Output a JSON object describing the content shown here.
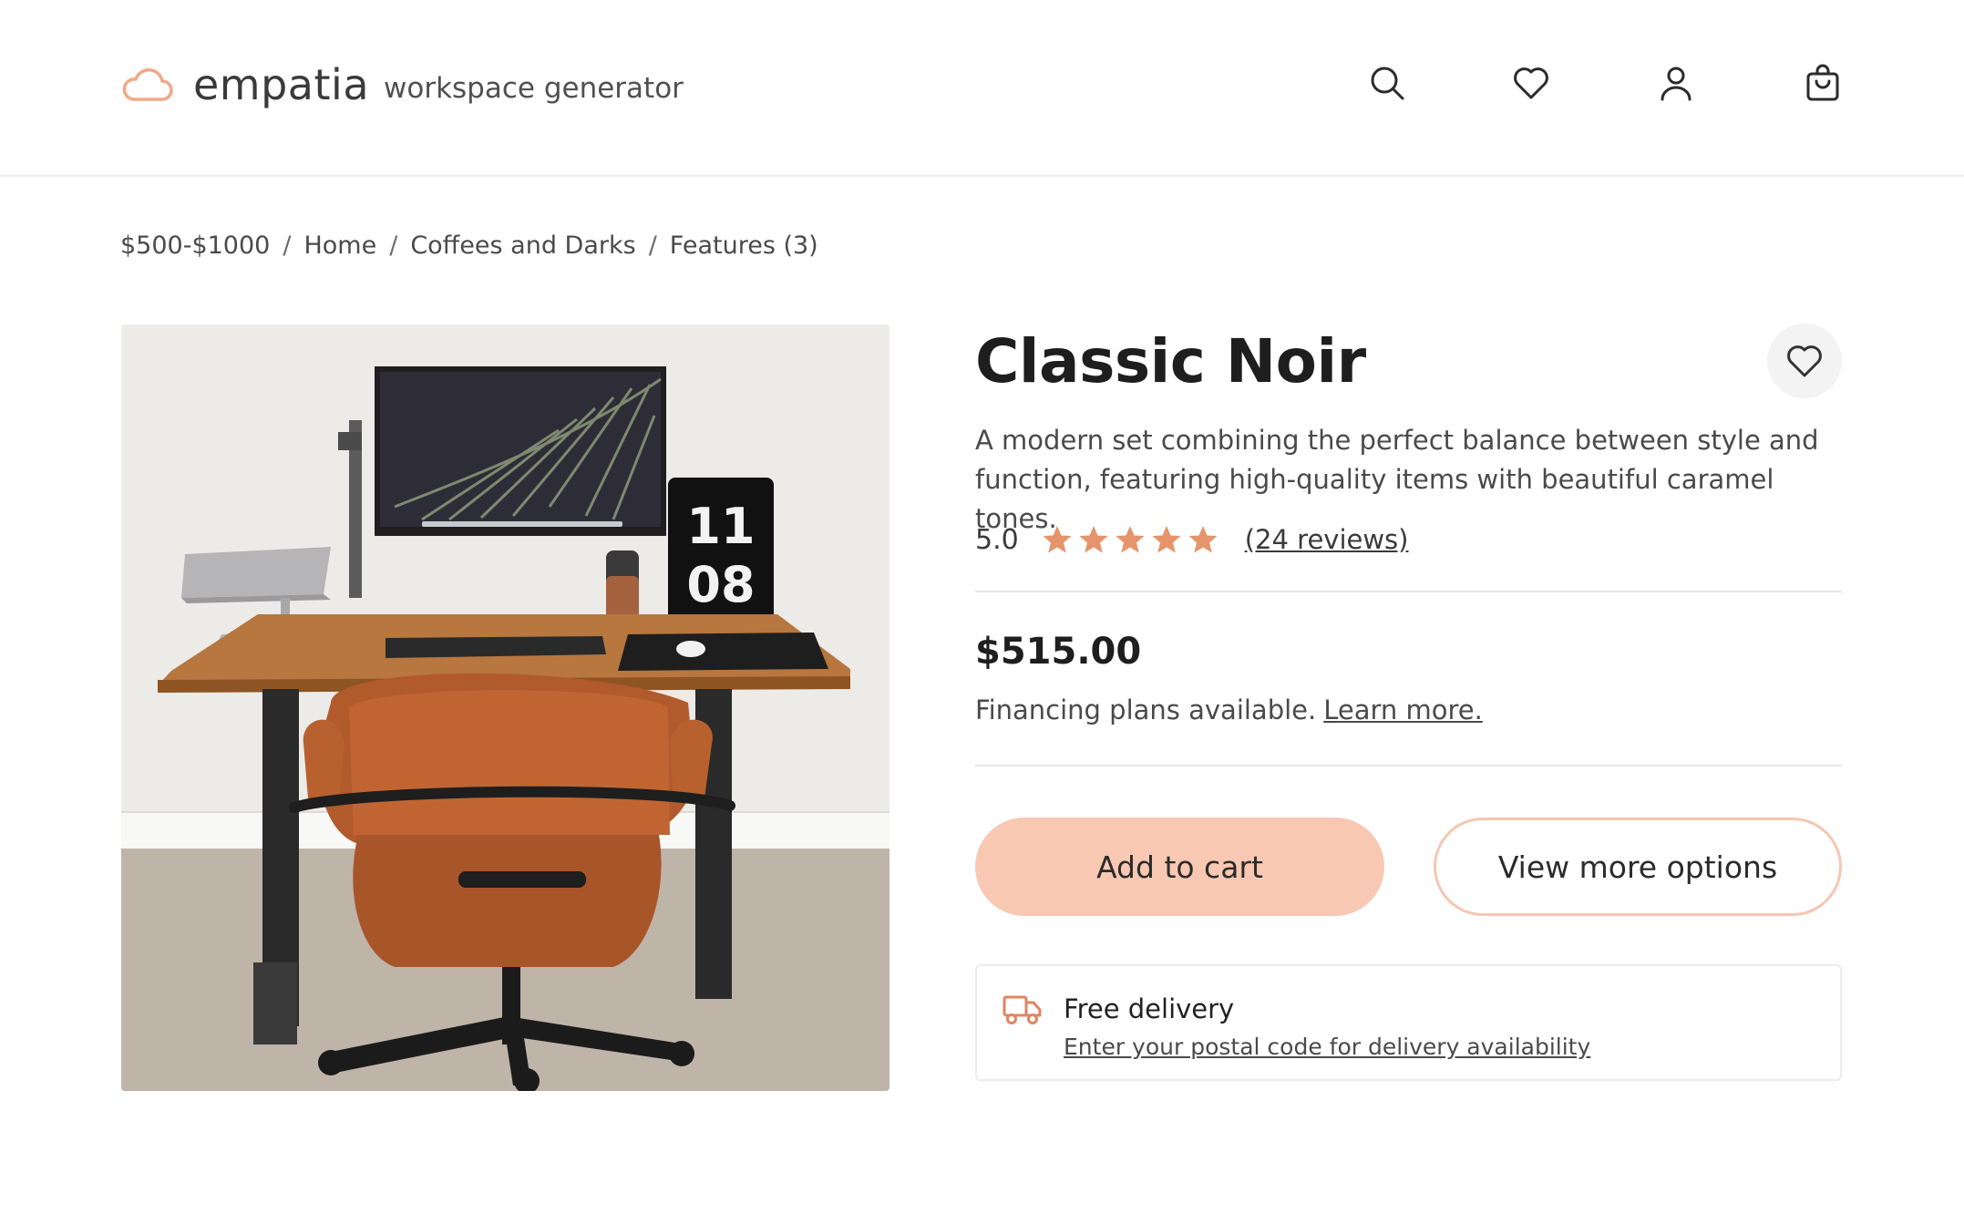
{
  "header": {
    "brand": "empatia",
    "tagline": "workspace generator",
    "icons": [
      "search-icon",
      "heart-icon",
      "user-icon",
      "shopping-bag-icon"
    ]
  },
  "breadcrumb": [
    "$500-$1000",
    "Home",
    "Coffees and Darks",
    "Features (3)"
  ],
  "product": {
    "title": "Classic Noir",
    "description": "A modern set combining the perfect balance between style and function, featuring high-quality items with beautiful caramel tones.",
    "rating": "5.0",
    "stars": 5,
    "reviews_label": "(24 reviews)",
    "price": "$515.00",
    "financing_text": "Financing plans available.",
    "financing_link": "Learn more.",
    "image_clock_hour": "11",
    "image_clock_minute": "08"
  },
  "actions": {
    "add_to_cart": "Add to cart",
    "view_more": "View more options"
  },
  "delivery": {
    "title": "Free delivery",
    "link": "Enter your postal code for delivery availability"
  },
  "colors": {
    "accent": "#f8c8b3",
    "accent_border": "#f5c7b2",
    "star": "#e6946b",
    "logo": "#f0a987",
    "truck": "#e28463",
    "text": "#2b2b2b"
  }
}
